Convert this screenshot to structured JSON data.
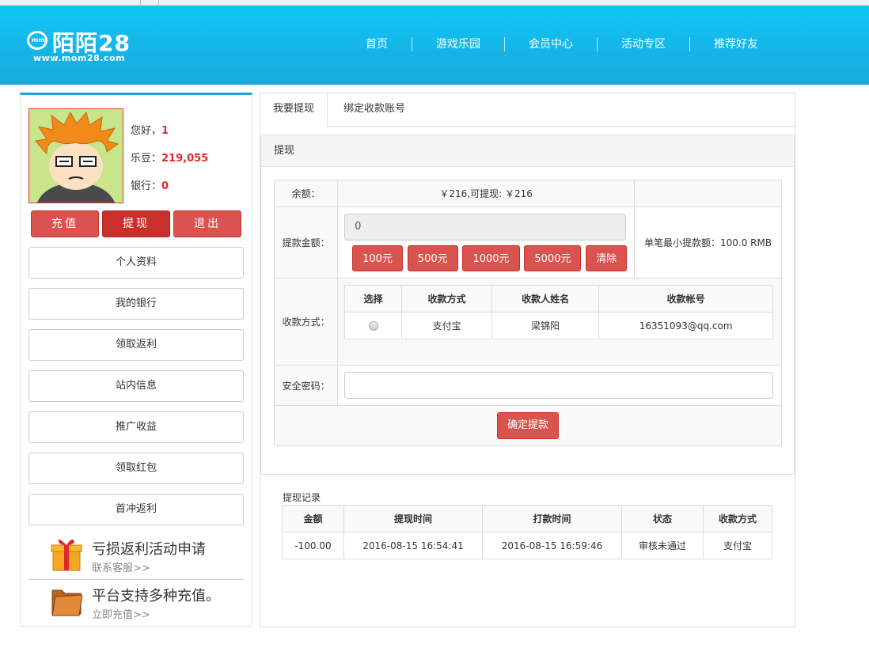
{
  "brand": {
    "logo_text": "陌陌28",
    "logo_badge": "mm",
    "url": "www.mom28.com",
    "primary_color": "#1aa8dc",
    "accent_color": "#d9534f"
  },
  "nav": [
    "首页",
    "游戏乐园",
    "会员中心",
    "活动专区",
    "推荐好友"
  ],
  "user": {
    "greeting_label": "您好，",
    "name": "1",
    "beans_label": "乐豆：",
    "beans": "219,055",
    "bank_label": "银行：",
    "bank": "0"
  },
  "actions": [
    "充值",
    "提现",
    "退出"
  ],
  "menu": [
    "个人资料",
    "我的银行",
    "领取返利",
    "站内信息",
    "推广收益",
    "领取红包",
    "首冲返利"
  ],
  "promos": [
    {
      "title": "亏损返利活动申请",
      "sub": "联系客服>>",
      "icon": "gift-icon"
    },
    {
      "title": "平台支持多种充值。",
      "sub": "立即充值>>",
      "icon": "folder-icon"
    }
  ],
  "tabs": [
    "我要提现",
    "绑定收款账号"
  ],
  "panel": {
    "title": "提现",
    "balance_label": "余额：",
    "balance_value": "￥216,可提现: ￥216",
    "amount_label": "提款金额：",
    "amount_value": "0",
    "quick_amounts": [
      "100元",
      "500元",
      "1000元",
      "5000元",
      "清除"
    ],
    "min_note": "单笔最小提款额：100.0 RMB",
    "method_label": "收款方式：",
    "method_headers": [
      "选择",
      "收款方式",
      "收款人姓名",
      "收款帐号"
    ],
    "method_row": {
      "method": "支付宝",
      "name": "梁锦阳",
      "account": "16351093@qq.com"
    },
    "password_label": "安全密码：",
    "confirm_label": "确定提款"
  },
  "records": {
    "title": "提现记录",
    "headers": [
      "金额",
      "提现时间",
      "打款时间",
      "状态",
      "收款方式"
    ],
    "rows": [
      [
        "-100.00",
        "2016-08-15 16:54:41",
        "2016-08-15 16:59:46",
        "审核未通过",
        "支付宝"
      ]
    ]
  }
}
